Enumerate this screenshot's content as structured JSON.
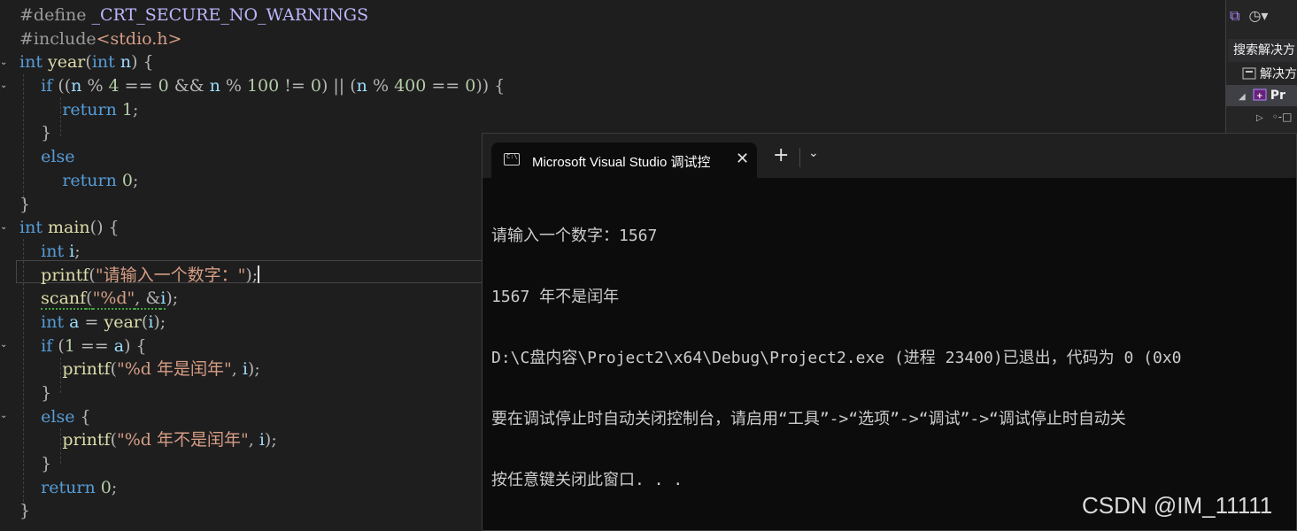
{
  "editor": {
    "lines": [
      {
        "tokens": [
          {
            "t": "#define ",
            "c": "pp"
          },
          {
            "t": "_CRT_SECURE_NO_WARNINGS",
            "c": "mac"
          }
        ]
      },
      {
        "tokens": [
          {
            "t": "#include",
            "c": "pp"
          },
          {
            "t": "<stdio.h>",
            "c": "str"
          }
        ]
      },
      {
        "tokens": [
          {
            "t": "int ",
            "c": "kw"
          },
          {
            "t": "year",
            "c": "fn"
          },
          {
            "t": "(",
            "c": "op"
          },
          {
            "t": "int ",
            "c": "kw"
          },
          {
            "t": "n",
            "c": "var"
          },
          {
            "t": ") {",
            "c": "op"
          }
        ]
      },
      {
        "tokens": [
          {
            "t": "    "
          },
          {
            "t": "if ",
            "c": "kw"
          },
          {
            "t": "((",
            "c": "op"
          },
          {
            "t": "n",
            "c": "var"
          },
          {
            "t": " % ",
            "c": "op"
          },
          {
            "t": "4",
            "c": "num"
          },
          {
            "t": " == ",
            "c": "op"
          },
          {
            "t": "0",
            "c": "num"
          },
          {
            "t": " && ",
            "c": "op"
          },
          {
            "t": "n",
            "c": "var"
          },
          {
            "t": " % ",
            "c": "op"
          },
          {
            "t": "100",
            "c": "num"
          },
          {
            "t": " != ",
            "c": "op"
          },
          {
            "t": "0",
            "c": "num"
          },
          {
            "t": ") || (",
            "c": "op"
          },
          {
            "t": "n",
            "c": "var"
          },
          {
            "t": " % ",
            "c": "op"
          },
          {
            "t": "400",
            "c": "num"
          },
          {
            "t": " == ",
            "c": "op"
          },
          {
            "t": "0",
            "c": "num"
          },
          {
            "t": ")) {",
            "c": "op"
          }
        ]
      },
      {
        "tokens": [
          {
            "t": "        "
          },
          {
            "t": "return ",
            "c": "kw"
          },
          {
            "t": "1",
            "c": "num"
          },
          {
            "t": ";",
            "c": "op"
          }
        ]
      },
      {
        "tokens": [
          {
            "t": "    "
          },
          {
            "t": "}",
            "c": "op"
          }
        ]
      },
      {
        "tokens": [
          {
            "t": "    "
          },
          {
            "t": "else",
            "c": "kw"
          }
        ]
      },
      {
        "tokens": [
          {
            "t": "        "
          },
          {
            "t": "return ",
            "c": "kw"
          },
          {
            "t": "0",
            "c": "num"
          },
          {
            "t": ";",
            "c": "op"
          }
        ]
      },
      {
        "tokens": [
          {
            "t": "}",
            "c": "op"
          }
        ]
      },
      {
        "tokens": [
          {
            "t": "int ",
            "c": "kw"
          },
          {
            "t": "main",
            "c": "fn"
          },
          {
            "t": "() {",
            "c": "op"
          }
        ]
      },
      {
        "tokens": [
          {
            "t": "    "
          },
          {
            "t": "int ",
            "c": "kw"
          },
          {
            "t": "i",
            "c": "var"
          },
          {
            "t": ";",
            "c": "op"
          }
        ]
      },
      {
        "tokens": [
          {
            "t": "    "
          },
          {
            "t": "printf",
            "c": "fn"
          },
          {
            "t": "(",
            "c": "op"
          },
          {
            "t": "\"请输入一个数字：\"",
            "c": "str"
          },
          {
            "t": ");",
            "c": "op"
          }
        ],
        "caret": true
      },
      {
        "tokens": [
          {
            "t": "    "
          },
          {
            "t": "scanf",
            "c": "fn squiggle"
          },
          {
            "t": "(",
            "c": "op squiggle"
          },
          {
            "t": "\"%d\"",
            "c": "str squiggle"
          },
          {
            "t": ", &",
            "c": "op squiggle"
          },
          {
            "t": "i",
            "c": "var squiggle"
          },
          {
            "t": ");",
            "c": "op"
          }
        ]
      },
      {
        "tokens": [
          {
            "t": "    "
          },
          {
            "t": "int ",
            "c": "kw"
          },
          {
            "t": "a",
            "c": "var"
          },
          {
            "t": " = ",
            "c": "op"
          },
          {
            "t": "year",
            "c": "fn"
          },
          {
            "t": "(",
            "c": "op"
          },
          {
            "t": "i",
            "c": "var"
          },
          {
            "t": ");",
            "c": "op"
          }
        ]
      },
      {
        "tokens": [
          {
            "t": "    "
          },
          {
            "t": "if ",
            "c": "kw"
          },
          {
            "t": "(",
            "c": "op"
          },
          {
            "t": "1",
            "c": "num"
          },
          {
            "t": " == ",
            "c": "op"
          },
          {
            "t": "a",
            "c": "var"
          },
          {
            "t": ") {",
            "c": "op"
          }
        ]
      },
      {
        "tokens": [
          {
            "t": "        "
          },
          {
            "t": "printf",
            "c": "fn"
          },
          {
            "t": "(",
            "c": "op"
          },
          {
            "t": "\"%d 年是闰年\"",
            "c": "str"
          },
          {
            "t": ", ",
            "c": "op"
          },
          {
            "t": "i",
            "c": "var"
          },
          {
            "t": ");",
            "c": "op"
          }
        ]
      },
      {
        "tokens": [
          {
            "t": "    "
          },
          {
            "t": "}",
            "c": "op"
          }
        ]
      },
      {
        "tokens": [
          {
            "t": "    "
          },
          {
            "t": "else ",
            "c": "kw"
          },
          {
            "t": "{",
            "c": "op"
          }
        ]
      },
      {
        "tokens": [
          {
            "t": "        "
          },
          {
            "t": "printf",
            "c": "fn"
          },
          {
            "t": "(",
            "c": "op"
          },
          {
            "t": "\"%d 年不是闰年\"",
            "c": "str"
          },
          {
            "t": ", ",
            "c": "op"
          },
          {
            "t": "i",
            "c": "var"
          },
          {
            "t": ");",
            "c": "op"
          }
        ]
      },
      {
        "tokens": [
          {
            "t": "    "
          },
          {
            "t": "}",
            "c": "op"
          }
        ]
      },
      {
        "tokens": [
          {
            "t": "    "
          },
          {
            "t": "return ",
            "c": "kw"
          },
          {
            "t": "0",
            "c": "num"
          },
          {
            "t": ";",
            "c": "op"
          }
        ]
      },
      {
        "tokens": [
          {
            "t": "}",
            "c": "op"
          }
        ]
      }
    ]
  },
  "solution_explorer": {
    "search_placeholder": "搜索解决方",
    "solution_label": "解决方",
    "project_label": "Pr"
  },
  "console": {
    "tab_title": "Microsoft Visual Studio 调试控",
    "close_glyph": "✕",
    "new_tab_glyph": "+",
    "dropdown_glyph": "⌄",
    "output_lines": [
      "请输入一个数字：1567",
      "1567 年不是闰年",
      "D:\\C盘内容\\Project2\\x64\\Debug\\Project2.exe (进程 23400)已退出，代码为 0 (0x0",
      "要在调试停止时自动关闭控制台，请启用“工具”->“选项”->“调试”->“调试停止时自动关",
      "按任意键关闭此窗口. . ."
    ]
  },
  "watermark": "CSDN @IM_11111",
  "colors": {
    "editor_bg": "#1e1e1e",
    "console_bg": "#0c0c0c",
    "keyword": "#569cd6",
    "string": "#d69d85",
    "function": "#dcdcaa"
  }
}
